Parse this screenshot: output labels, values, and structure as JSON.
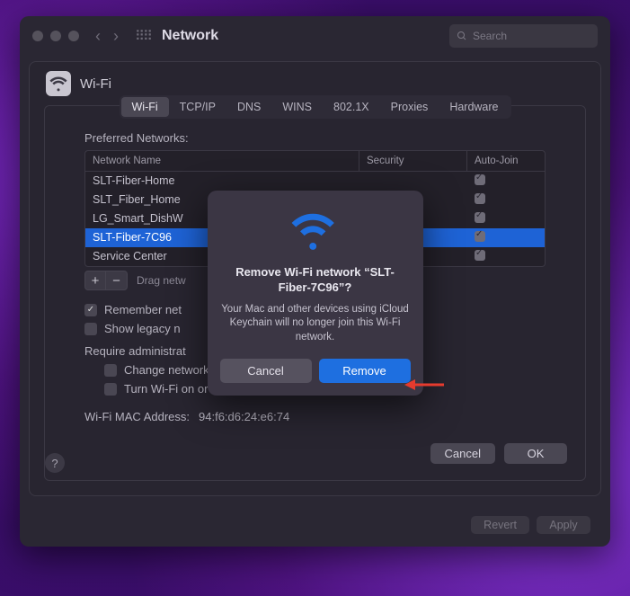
{
  "window": {
    "title": "Network",
    "search_placeholder": "Search"
  },
  "panel": {
    "title": "Wi-Fi"
  },
  "tabs": [
    "Wi-Fi",
    "TCP/IP",
    "DNS",
    "WINS",
    "802.1X",
    "Proxies",
    "Hardware"
  ],
  "active_tab_index": 0,
  "preferred_label": "Preferred Networks:",
  "columns": {
    "name": "Network Name",
    "security": "Security",
    "autojoin": "Auto-Join"
  },
  "networks": [
    {
      "name": "SLT-Fiber-Home",
      "autojoin": true,
      "selected": false
    },
    {
      "name": "SLT_Fiber_Home",
      "autojoin": true,
      "selected": false
    },
    {
      "name": "LG_Smart_DishW",
      "autojoin": true,
      "selected": false
    },
    {
      "name": "SLT-Fiber-7C96",
      "autojoin": true,
      "selected": true
    },
    {
      "name": "Service Center",
      "autojoin": true,
      "selected": false
    }
  ],
  "drag_hint": "Drag netw",
  "options": {
    "remember": {
      "label": "Remember net",
      "checked": true
    },
    "legacy": {
      "label": "Show legacy n",
      "checked": false
    },
    "require_label": "Require administrat",
    "change_networks": {
      "label": "Change networks",
      "checked": false
    },
    "turn_wifi": {
      "label": "Turn Wi-Fi on or off",
      "checked": false
    }
  },
  "mac": {
    "label": "Wi-Fi MAC Address:",
    "value": "94:f6:d6:24:e6:74"
  },
  "buttons": {
    "cancel": "Cancel",
    "ok": "OK",
    "revert": "Revert",
    "apply": "Apply"
  },
  "modal": {
    "title": "Remove Wi-Fi network “SLT-Fiber-7C96”?",
    "body": "Your Mac and other devices using iCloud Keychain will no longer join this Wi-Fi network.",
    "cancel": "Cancel",
    "remove": "Remove"
  }
}
